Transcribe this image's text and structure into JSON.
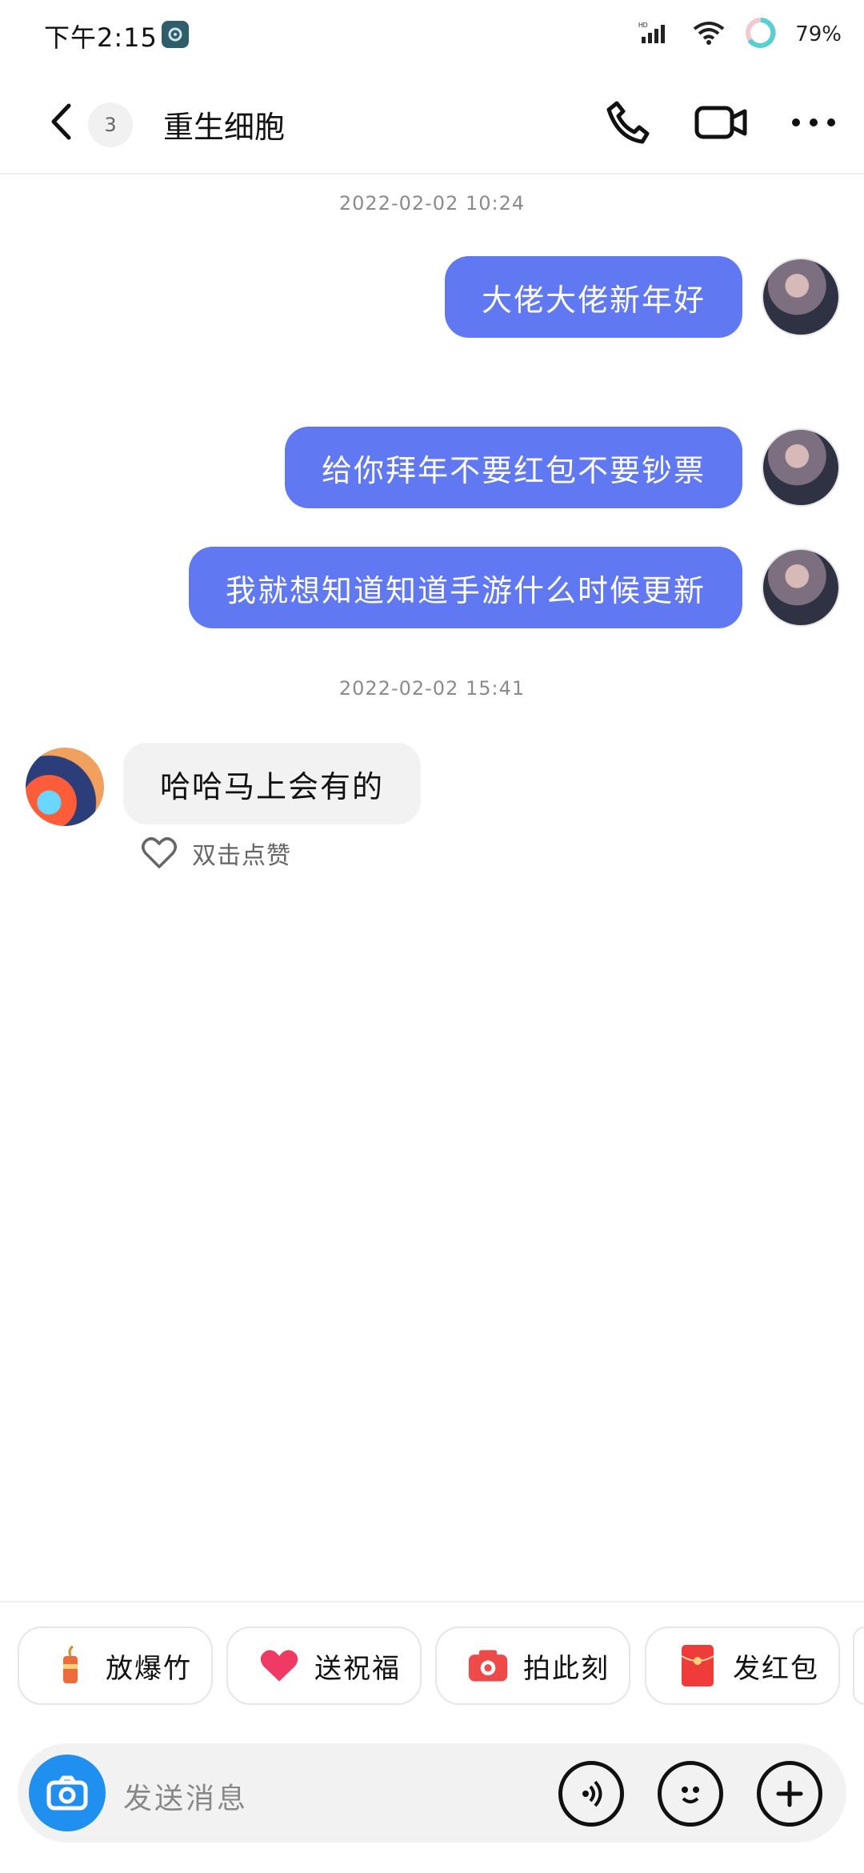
{
  "status_bar": {
    "time": "下午2:15",
    "battery_text": "79%"
  },
  "header": {
    "unread_count": "3",
    "title": "重生细胞"
  },
  "messages": {
    "timestamp_1": "2022-02-02 10:24",
    "outgoing": [
      "大佬大佬新年好",
      "给你拜年不要红包不要钞票",
      "我就想知道知道手游什么时候更新"
    ],
    "timestamp_2": "2022-02-02 15:41",
    "incoming": "哈哈马上会有的",
    "like_hint": "双击点赞"
  },
  "quick_actions": [
    {
      "label": "放爆竹",
      "icon": "firecracker-icon"
    },
    {
      "label": "送祝福",
      "icon": "heart-icon"
    },
    {
      "label": "拍此刻",
      "icon": "camera-sticker-icon"
    },
    {
      "label": "发红包",
      "icon": "red-envelope-icon"
    }
  ],
  "input": {
    "placeholder": "发送消息"
  },
  "colors": {
    "accent": "#6078f2",
    "camera": "#1f8ff0",
    "incoming_bubble": "#f2f2f2"
  }
}
